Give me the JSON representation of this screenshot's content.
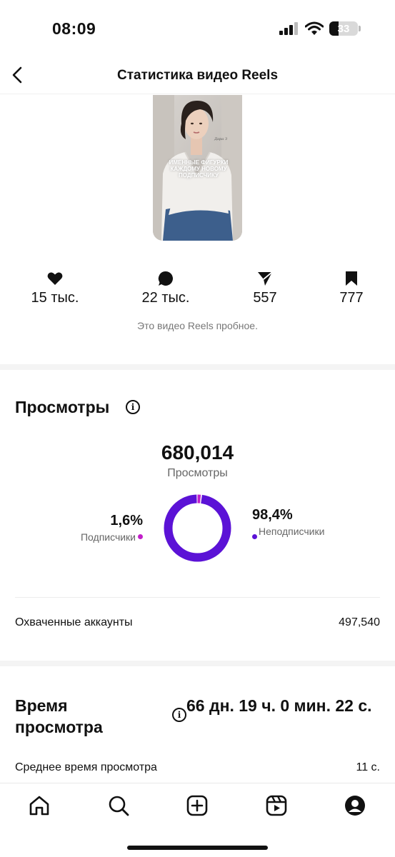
{
  "status_bar": {
    "time": "08:09",
    "battery": "33"
  },
  "nav": {
    "title": "Статистика видео Reels"
  },
  "thumbnail": {
    "caption": "ИМЕННЫЕ ФИГУРКИ КАЖДОМУ НОВОМУ ПОДПИСЧИКУ",
    "signature": "Дара З"
  },
  "stats": [
    {
      "icon": "heart-icon",
      "value": "15 тыс."
    },
    {
      "icon": "comment-icon",
      "value": "22 тыс."
    },
    {
      "icon": "share-icon",
      "value": "557"
    },
    {
      "icon": "bookmark-icon",
      "value": "777"
    }
  ],
  "trial_note": "Это видео Reels пробное.",
  "views": {
    "title": "Просмотры",
    "total": "680,014",
    "total_label": "Просмотры",
    "followers_pct": "1,6%",
    "followers_label": "Подписчики",
    "followers_fraction": 0.016,
    "non_followers_pct": "98,4%",
    "non_followers_label": "Неподписчики",
    "non_followers_fraction": 0.984,
    "colors": {
      "followers": "#c21fc9",
      "non_followers": "#5b12d6"
    }
  },
  "reached": {
    "label": "Охваченные аккаунты",
    "value": "497,540"
  },
  "watch_time": {
    "title": "Время просмотра",
    "value": "66 дн. 19 ч. 0 мин. 22 с.",
    "avg_label": "Среднее время просмотра",
    "avg_value": "11 с."
  },
  "tab_bar": [
    "home-icon",
    "search-icon",
    "create-icon",
    "reels-icon",
    "profile-icon"
  ]
}
